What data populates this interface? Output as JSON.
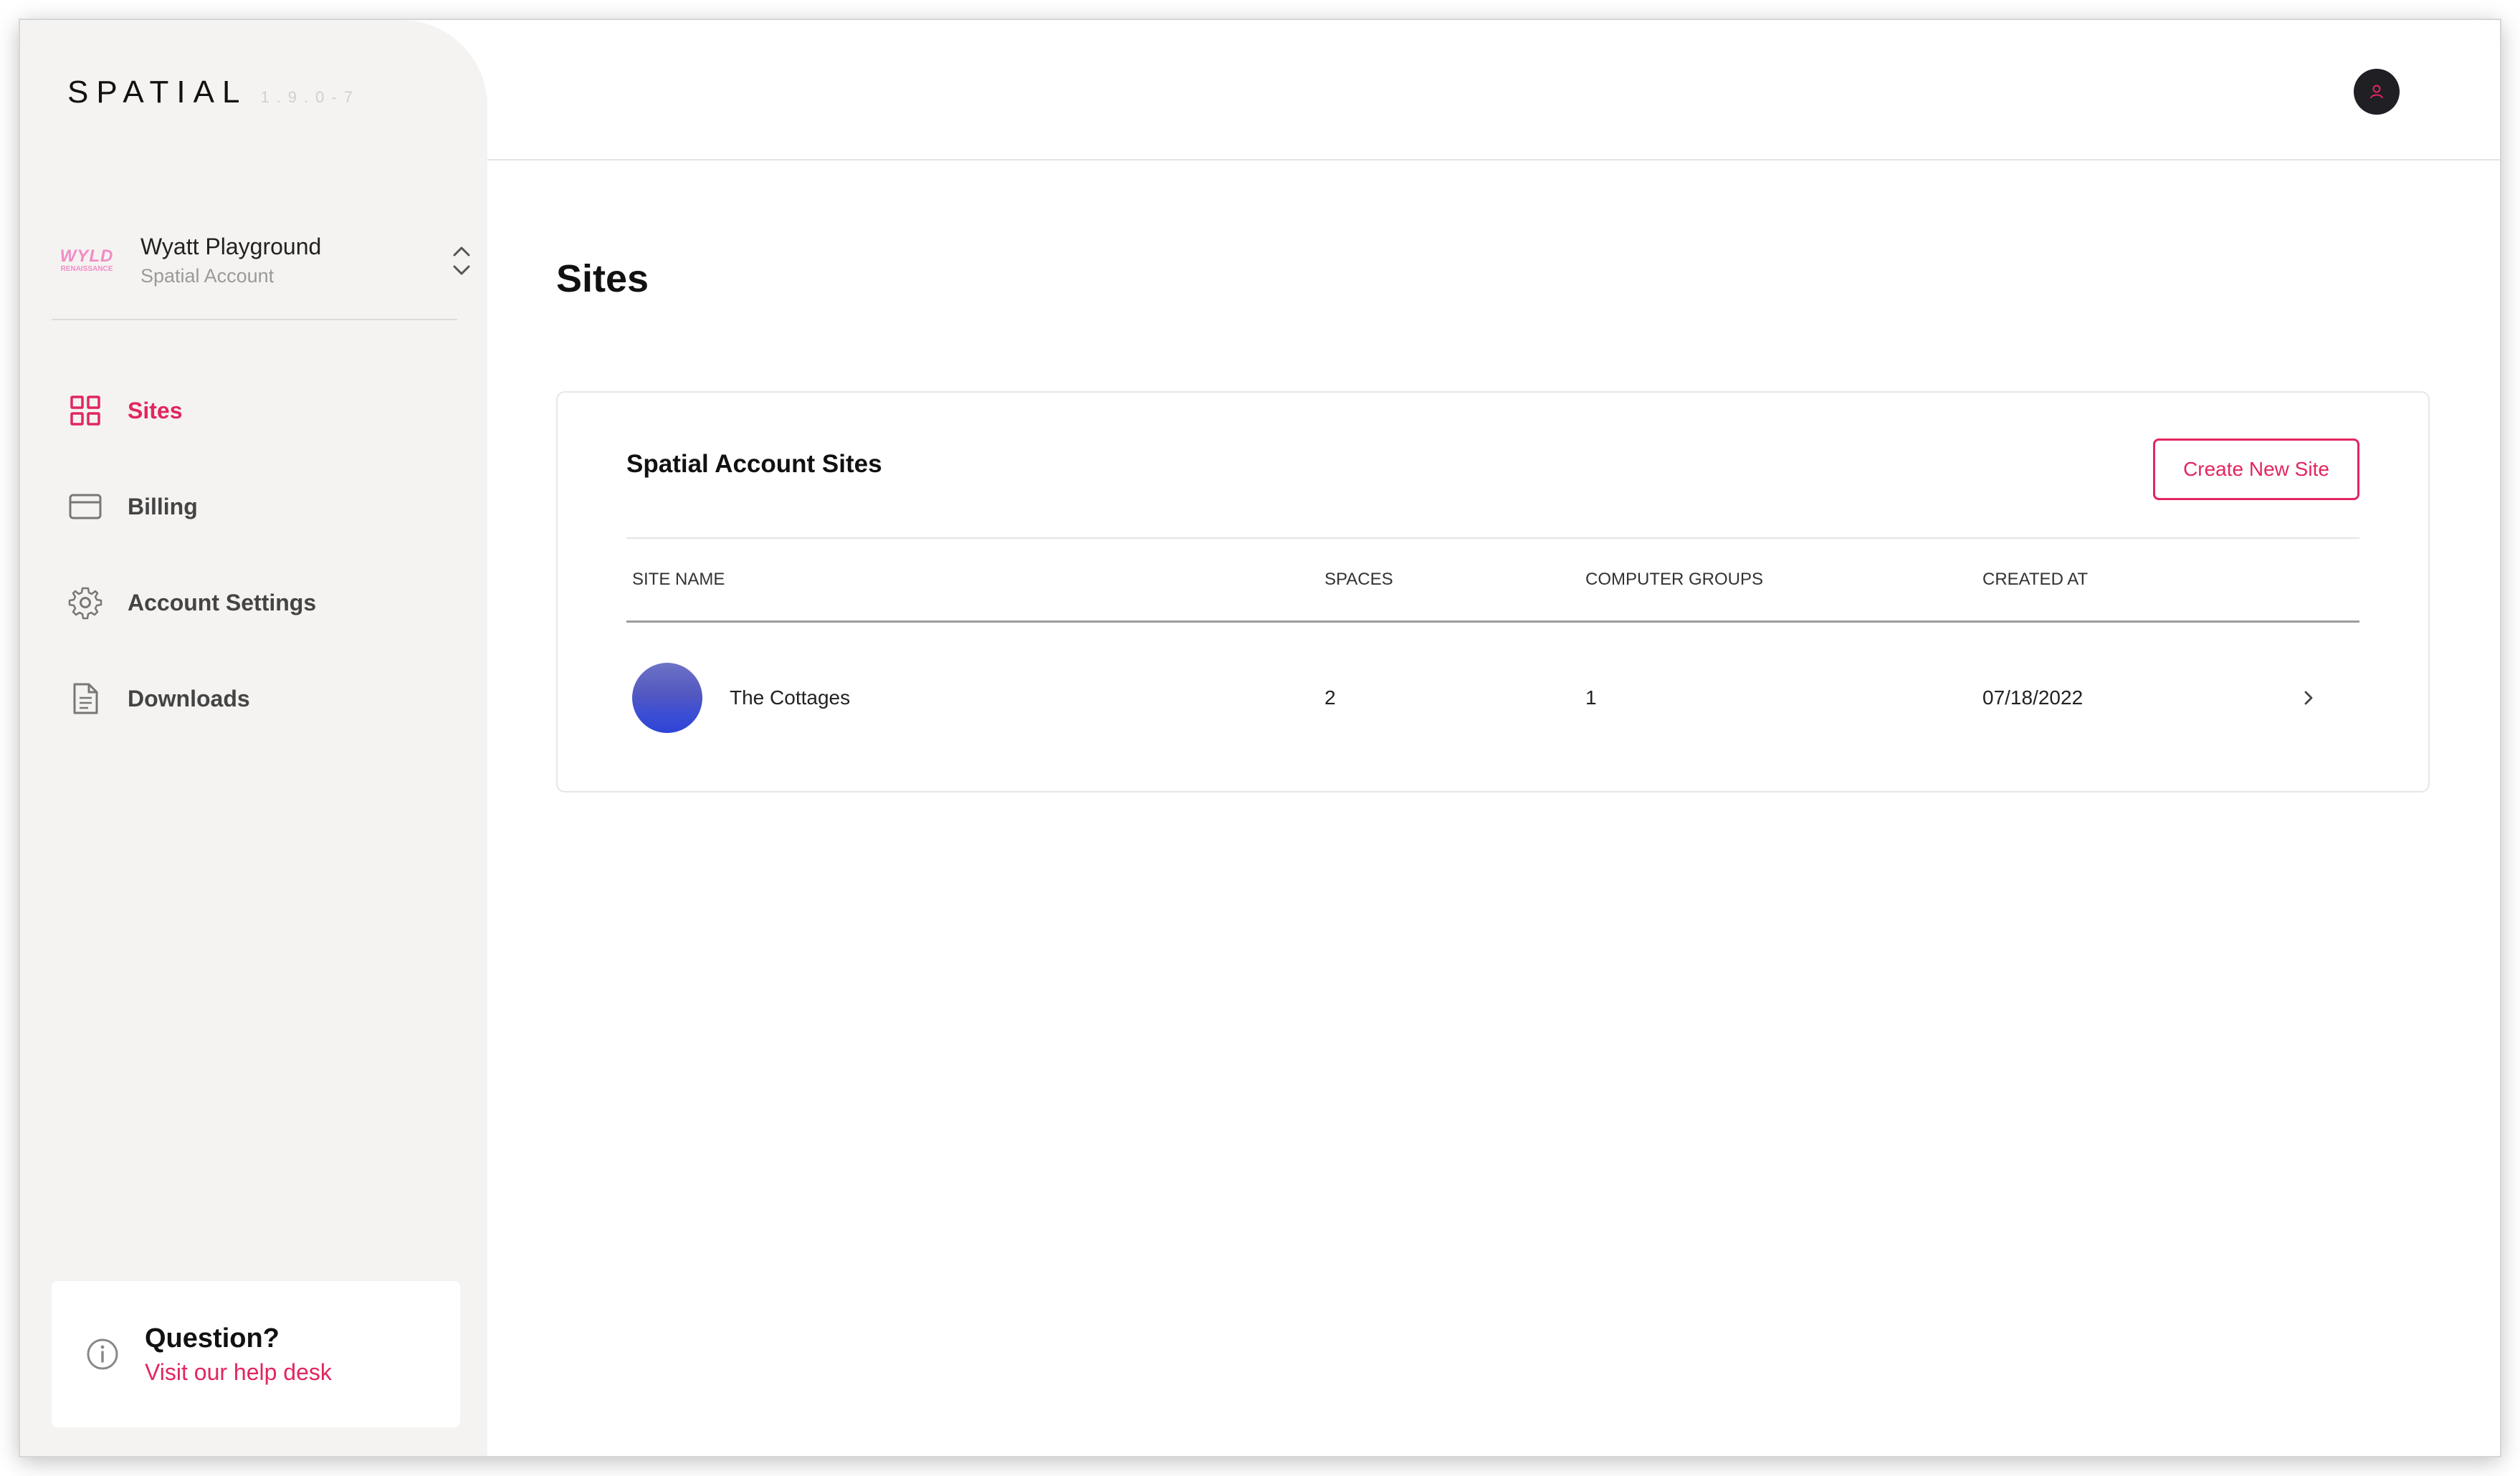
{
  "app": {
    "brand": "SPATIAL",
    "version": "1.9.0-7"
  },
  "account": {
    "logo_text": "WYLD",
    "logo_subtext": "RENAISSANCE",
    "name": "Wyatt Playground",
    "type": "Spatial Account",
    "toggle_icon": "chevron-up-down-icon"
  },
  "sidebar": {
    "items": [
      {
        "label": "Sites",
        "icon": "grid-icon",
        "active": true
      },
      {
        "label": "Billing",
        "icon": "credit-card-icon",
        "active": false
      },
      {
        "label": "Account Settings",
        "icon": "gear-icon",
        "active": false
      },
      {
        "label": "Downloads",
        "icon": "document-icon",
        "active": false
      }
    ]
  },
  "help": {
    "title": "Question?",
    "link": "Visit our help desk",
    "icon": "info-icon"
  },
  "topbar": {
    "avatar_icon": "user-icon"
  },
  "main": {
    "page_title": "Sites",
    "card_title": "Spatial Account Sites",
    "create_button": "Create New Site",
    "columns": [
      "SITE NAME",
      "SPACES",
      "COMPUTER GROUPS",
      "CREATED AT"
    ],
    "rows": [
      {
        "site_name": "The Cottages",
        "spaces": "2",
        "computer_groups": "1",
        "created_at": "07/18/2022"
      }
    ]
  },
  "colors": {
    "accent": "#e2265f",
    "sidebar_bg": "#f4f3f1"
  }
}
